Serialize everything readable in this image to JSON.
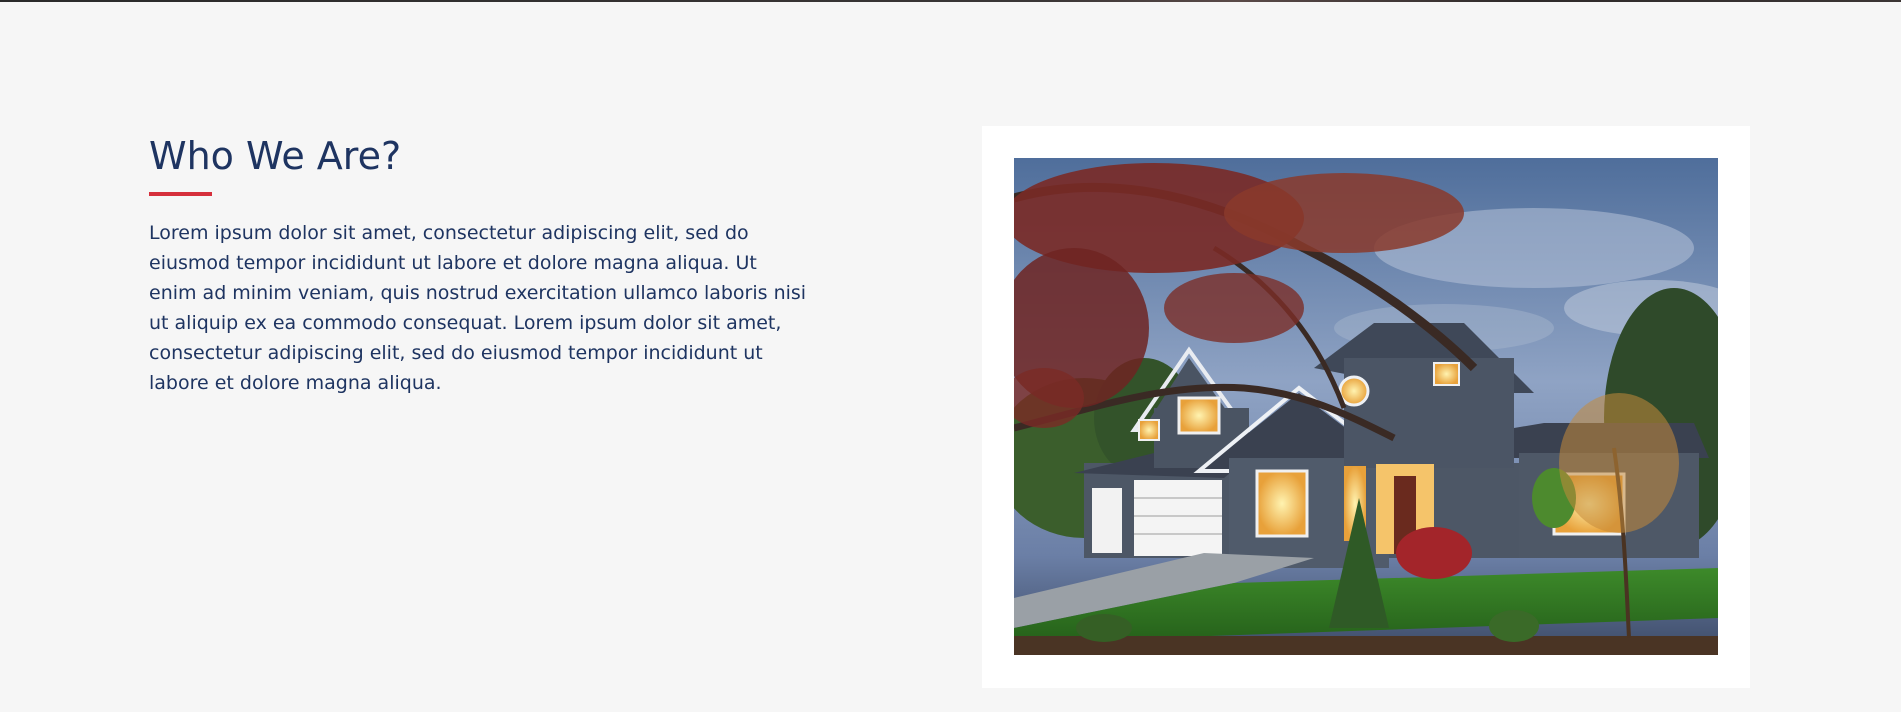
{
  "about": {
    "title": "Who We Are?",
    "body": "Lorem ipsum dolor sit amet, consectetur adipiscing elit, sed do eiusmod tempor incididunt ut labore et dolore magna aliqua. Ut enim ad minim veniam, quis nostrud exercitation ullamco laboris nisi ut aliquip ex ea commodo consequat. Lorem ipsum dolor sit amet, consectetur adipiscing elit, sed do eiusmod tempor incididunt ut labore et dolore magna aliqua.",
    "image_icon": "house-photo-icon"
  },
  "colors": {
    "background": "#f6f6f6",
    "heading": "#1e3461",
    "accent": "#d6303c",
    "frame": "#ffffff"
  }
}
